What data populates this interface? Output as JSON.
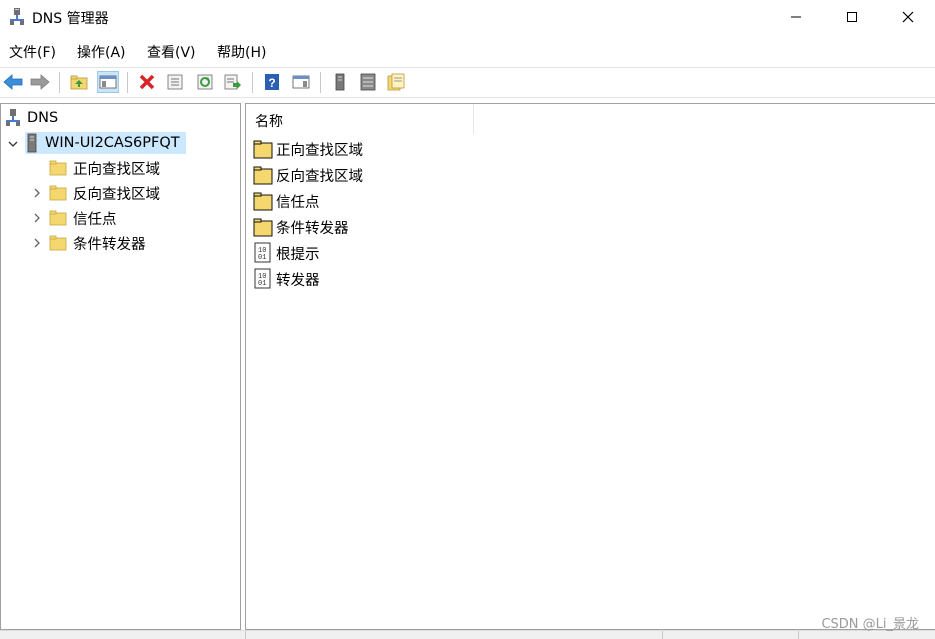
{
  "window": {
    "title": "DNS 管理器"
  },
  "menu": {
    "file": "文件(F)",
    "action": "操作(A)",
    "view": "查看(V)",
    "help": "帮助(H)"
  },
  "tree": {
    "root": "DNS",
    "server": "WIN-UI2CAS6PFQT",
    "children": [
      "正向查找区域",
      "反向查找区域",
      "信任点",
      "条件转发器"
    ]
  },
  "list": {
    "column_name": "名称",
    "items": [
      "正向查找区域",
      "反向查找区域",
      "信任点",
      "条件转发器",
      "根提示",
      "转发器"
    ]
  },
  "watermark": "CSDN @Li_景龙",
  "colors": {
    "selection": "#cce8ff",
    "folder": "#f5d770",
    "delete_red": "#d9242a",
    "help_blue": "#2b5fb4",
    "nav_blue": "#3b8fd9"
  }
}
